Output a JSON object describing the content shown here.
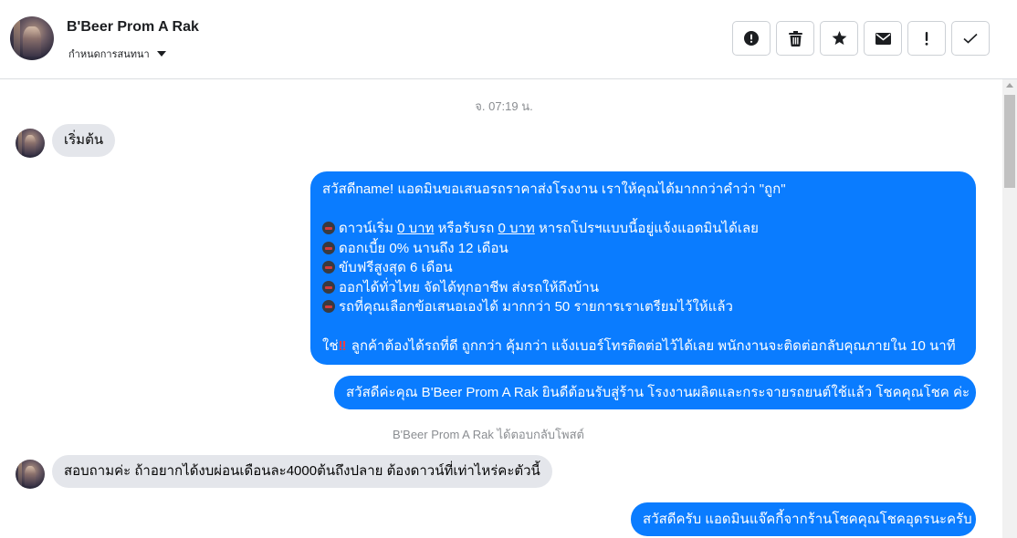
{
  "header": {
    "title": "B'Beer Prom A Rak",
    "subtitle": "กำหนดการสนทนา",
    "toolbar": [
      {
        "icon": "alert-circle-icon"
      },
      {
        "icon": "trash-icon"
      },
      {
        "icon": "star-icon"
      },
      {
        "icon": "envelope-icon"
      },
      {
        "icon": "exclamation-icon"
      },
      {
        "icon": "check-icon"
      }
    ]
  },
  "conversation": {
    "timestamp": "จ. 07:19 น.",
    "messages": {
      "m1": "เริ่มต้น",
      "m2": {
        "l1": "สวัสดีname! แอดมินขอเสนอรถราคาส่งโรงงาน เราให้คุณได้มากกว่าคำว่า \"ถูก\"",
        "l2a": "ดาวน์เริ่ม ",
        "l2b": "0 บาท",
        "l2c": " หรือรับรถ ",
        "l2d": "0 บาท",
        "l2e": " หารถโปรฯแบบนี้อยู่แจ้งแอดมินได้เลย",
        "l3": "ดอกเบี้ย 0% นานถึง 12 เดือน",
        "l4": "ขับฟรีสูงสุด 6 เดือน",
        "l5": "ออกได้ทั่วไทย จัดได้ทุกอาชีพ ส่งรถให้ถึงบ้าน",
        "l6": "รถที่คุณเลือกข้อเสนอเองได้ มากกว่า 50 รายการเราเตรียมไว้ให้แล้ว",
        "l7a": "ใช่",
        "l7b": "‼",
        "l7c": " ลูกค้าต้องได้รถที่ดี ถูกกว่า คุ้มกว่า แจ้งเบอร์โทรติดต่อไว้ได้เลย พนักงานจะติดต่อกลับคุณภายใน 10 นาที"
      },
      "m3": "สวัสดีค่ะคุณ B'Beer Prom A Rak ยินดีต้อนรับสู่ร้าน โรงงานผลิตและกระจายรถยนต์ใช้แล้ว โชคคุณโชค ค่ะ",
      "system": "B'Beer Prom A Rak ได้ตอบกลับโพสต์",
      "m4": "สอบถามค่ะ ถ้าอยากได้งบผ่อนเดือนละ4000ต้นถึงปลาย ต้องดาวน์ที่เท่าไหร่คะตัวนี้",
      "m5": "สวัสดีครับ แอดมินแจ๊คกี้จากร้านโชคคุณโชคอุดรนะครับ"
    }
  },
  "colors": {
    "outgoing_bubble": "#0a7cff",
    "incoming_bubble": "#e4e6eb",
    "meta_text": "#8a8d91"
  }
}
